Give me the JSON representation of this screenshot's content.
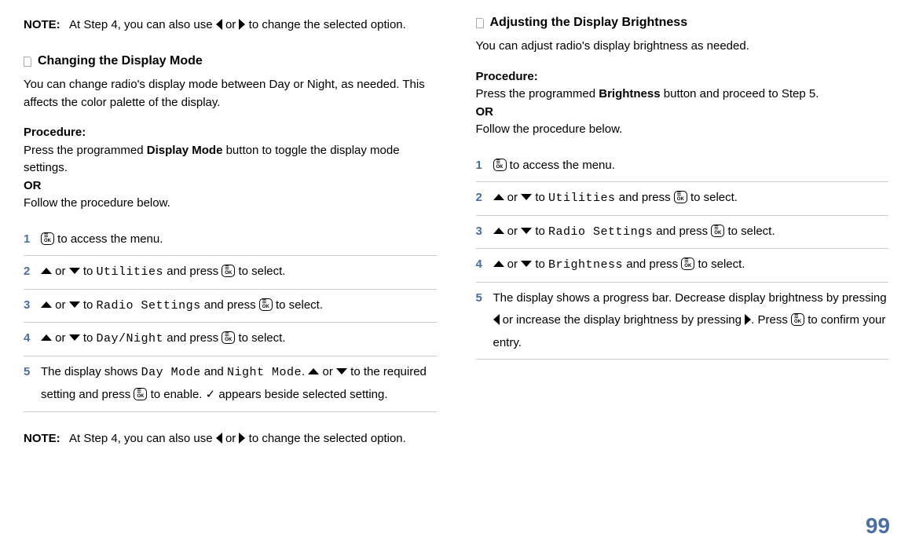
{
  "left": {
    "note1": {
      "label": "NOTE:",
      "text_a": "At Step 4, you can also use ",
      "text_b": " or ",
      "text_c": " to change the selected option."
    },
    "title": "Changing the Display Mode",
    "intro": "You can change radio's display mode between Day or Night, as needed. This affects the color palette of the display.",
    "proc_label": "Procedure:",
    "proc1a": "Press the programmed ",
    "proc1b": "Display Mode",
    "proc1c": " button to toggle the display mode settings.",
    "or": "OR",
    "proc2": "Follow the procedure below.",
    "steps": {
      "s1": {
        "num": "1",
        "a": " to access the menu."
      },
      "s2": {
        "num": "2",
        "a": " or ",
        "b": " to ",
        "c": "Utilities",
        "d": " and press ",
        "e": " to select."
      },
      "s3": {
        "num": "3",
        "a": " or ",
        "b": " to ",
        "c": "Radio Settings",
        "d": " and press ",
        "e": " to select."
      },
      "s4": {
        "num": "4",
        "a": " or ",
        "b": " to ",
        "c": "Day/Night",
        "d": " and press ",
        "e": " to select."
      },
      "s5": {
        "num": "5",
        "a": "The display shows ",
        "b": "Day Mode",
        "c": " and ",
        "d": "Night Mode",
        "e": ". ",
        "f": " or ",
        "g": " to the required setting and press ",
        "h": " to enable. ",
        "i": " appears beside selected setting."
      }
    },
    "note2": {
      "label": "NOTE:",
      "text_a": "At Step 4, you can also use ",
      "text_b": " or ",
      "text_c": " to change the selected option."
    }
  },
  "right": {
    "title": "Adjusting the Display Brightness",
    "intro": "You can adjust radio's display brightness as needed.",
    "proc_label": "Procedure:",
    "proc1a": "Press the programmed ",
    "proc1b": "Brightness",
    "proc1c": " button and proceed to Step 5.",
    "or": "OR",
    "proc2": "Follow the procedure below.",
    "steps": {
      "s1": {
        "num": "1",
        "a": " to access the menu."
      },
      "s2": {
        "num": "2",
        "a": " or ",
        "b": " to ",
        "c": "Utilities",
        "d": " and press ",
        "e": " to select."
      },
      "s3": {
        "num": "3",
        "a": " or ",
        "b": " to ",
        "c": "Radio Settings",
        "d": " and press ",
        "e": " to select."
      },
      "s4": {
        "num": "4",
        "a": " or ",
        "b": " to ",
        "c": "Brightness",
        "d": " and press ",
        "e": " to select."
      },
      "s5": {
        "num": "5",
        "a": "The display shows a progress bar. Decrease display brightness by pressing ",
        "b": " or increase the display brightness by pressing ",
        "c": ". Press ",
        "d": " to confirm your entry."
      }
    }
  },
  "page_number": "99"
}
